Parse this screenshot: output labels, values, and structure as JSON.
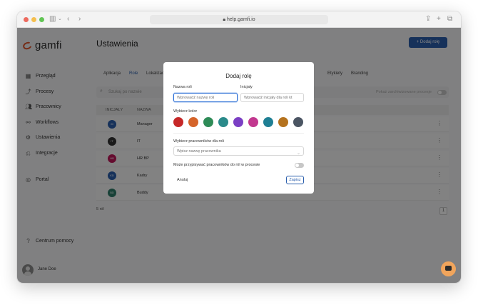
{
  "browser": {
    "url": "help.gamfi.io"
  },
  "app": {
    "logo_text": "gamfi"
  },
  "sidebar": {
    "items": [
      {
        "label": "Przegląd",
        "icon": "grid-icon"
      },
      {
        "label": "Procesy",
        "icon": "process-icon"
      },
      {
        "label": "Pracownicy",
        "icon": "users-icon"
      },
      {
        "label": "Workflows",
        "icon": "workflow-icon"
      },
      {
        "label": "Ustawienia",
        "icon": "gear-icon"
      },
      {
        "label": "Integracje",
        "icon": "integration-icon"
      },
      {
        "label": "Portal",
        "icon": "portal-icon"
      }
    ],
    "help_label": "Centrum pomocy",
    "user_name": "Jane Doe"
  },
  "main": {
    "title": "Ustawienia",
    "add_role_label": "+ Dodaj rolę",
    "tabs": [
      {
        "label": "Aplikacja"
      },
      {
        "label": "Role",
        "active": true
      },
      {
        "label": "Lokalizac"
      },
      {
        "label": "Etykiety"
      },
      {
        "label": "Branding"
      }
    ],
    "search_placeholder": "Szukaj po nazwie",
    "archived_toggle_label": "Pokaż zarchiwizowane procesje",
    "columns": [
      "INICJAŁY",
      "NAZWA"
    ],
    "rows": [
      {
        "initials": "M",
        "name": "Manager",
        "color": "#2b5fad"
      },
      {
        "initials": "IT",
        "name": "IT",
        "color": "#333333"
      },
      {
        "initials": "HB",
        "name": "HR BP",
        "color": "#c2185b"
      },
      {
        "initials": "KD",
        "name": "Kadry",
        "color": "#2b5fad"
      },
      {
        "initials": "BD",
        "name": "Buddy",
        "color": "#2e7d6a"
      }
    ],
    "count_label": "5 ról",
    "page": "1"
  },
  "modal": {
    "title": "Dodaj rolę",
    "role_name_label": "Nazwa roli",
    "role_name_placeholder": "Wprowadź nazwę roli",
    "initials_label": "Inicjały",
    "initials_placeholder": "Wprowadź inicjały dla roli kt",
    "color_label": "Wybierz kolor",
    "colors": [
      "#c62828",
      "#d5642a",
      "#2e8b57",
      "#2a8a8a",
      "#7b3fc4",
      "#c2388f",
      "#1f7f94",
      "#b5731f",
      "#4b5563"
    ],
    "employees_label": "Wybierz pracowników dla roli",
    "employees_placeholder": "Wpisz nazwę pracownika",
    "assign_label": "Może przypisywać pracowników do ról w procesie",
    "cancel_label": "Anuluj",
    "save_label": "Zapisz"
  }
}
